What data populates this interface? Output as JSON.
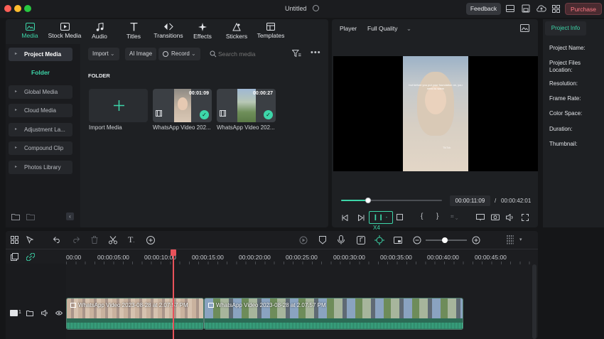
{
  "window": {
    "title": "Untitled",
    "feedback": "Feedback",
    "purchase": "Purchase"
  },
  "media_tabs": [
    {
      "label": "Media",
      "icon": "media-icon",
      "active": true
    },
    {
      "label": "Stock Media",
      "icon": "stock-media-icon"
    },
    {
      "label": "Audio",
      "icon": "music-note-icon"
    },
    {
      "label": "Titles",
      "icon": "text-t-icon"
    },
    {
      "label": "Transitions",
      "icon": "transitions-icon"
    },
    {
      "label": "Effects",
      "icon": "sparkle-icon"
    },
    {
      "label": "Stickers",
      "icon": "sticker-icon"
    },
    {
      "label": "Templates",
      "icon": "templates-icon"
    }
  ],
  "sidebar": {
    "project_media": "Project Media",
    "folder": "Folder",
    "items": [
      "Global Media",
      "Cloud Media",
      "Adjustment La...",
      "Compound Clip",
      "Photos Library"
    ]
  },
  "toolbar": {
    "import": "Import",
    "ai_image": "AI Image",
    "record": "Record",
    "search_placeholder": "Search media"
  },
  "library": {
    "folder_label": "FOLDER",
    "import_label": "Import Media",
    "clips": [
      {
        "name": "WhatsApp Video 202...",
        "duration": "00:01:09"
      },
      {
        "name": "WhatsApp Video 202...",
        "duration": "00:00:27"
      }
    ]
  },
  "player": {
    "label": "Player",
    "quality": "Full Quality",
    "current_time": "00:00:11:09",
    "separator": "/",
    "total_time": "00:00:42:01",
    "speed": "-X4",
    "progress": 0.27,
    "caption": "but before you put your foundation on, you need to warm",
    "watermark": "TikTok"
  },
  "project_info": {
    "header": "Project Info",
    "fields": [
      "Project Name:",
      "Project Files Location:",
      "Resolution:",
      "Frame Rate:",
      "Color Space:",
      "Duration:",
      "Thumbnail:"
    ]
  },
  "timeline": {
    "ruler": [
      "00:00",
      "00:00:05:00",
      "00:00:10:00",
      "00:00:15:00",
      "00:00:20:00",
      "00:00:25:00",
      "00:00:30:00",
      "00:00:35:00",
      "00:00:40:00",
      "00:00:45:00"
    ],
    "playhead_time": "00:00:11:09",
    "track_number": "1",
    "clips": [
      {
        "name": "WhatsApp Video 2023-08-28 at 2.07.57 PM"
      },
      {
        "name": "WhatsApp Video 2023-08-28 at 2.07.57 PM"
      }
    ]
  },
  "colors": {
    "accent": "#3dd6a9",
    "playhead": "#e8525a",
    "purchase": "#e55a6b"
  }
}
